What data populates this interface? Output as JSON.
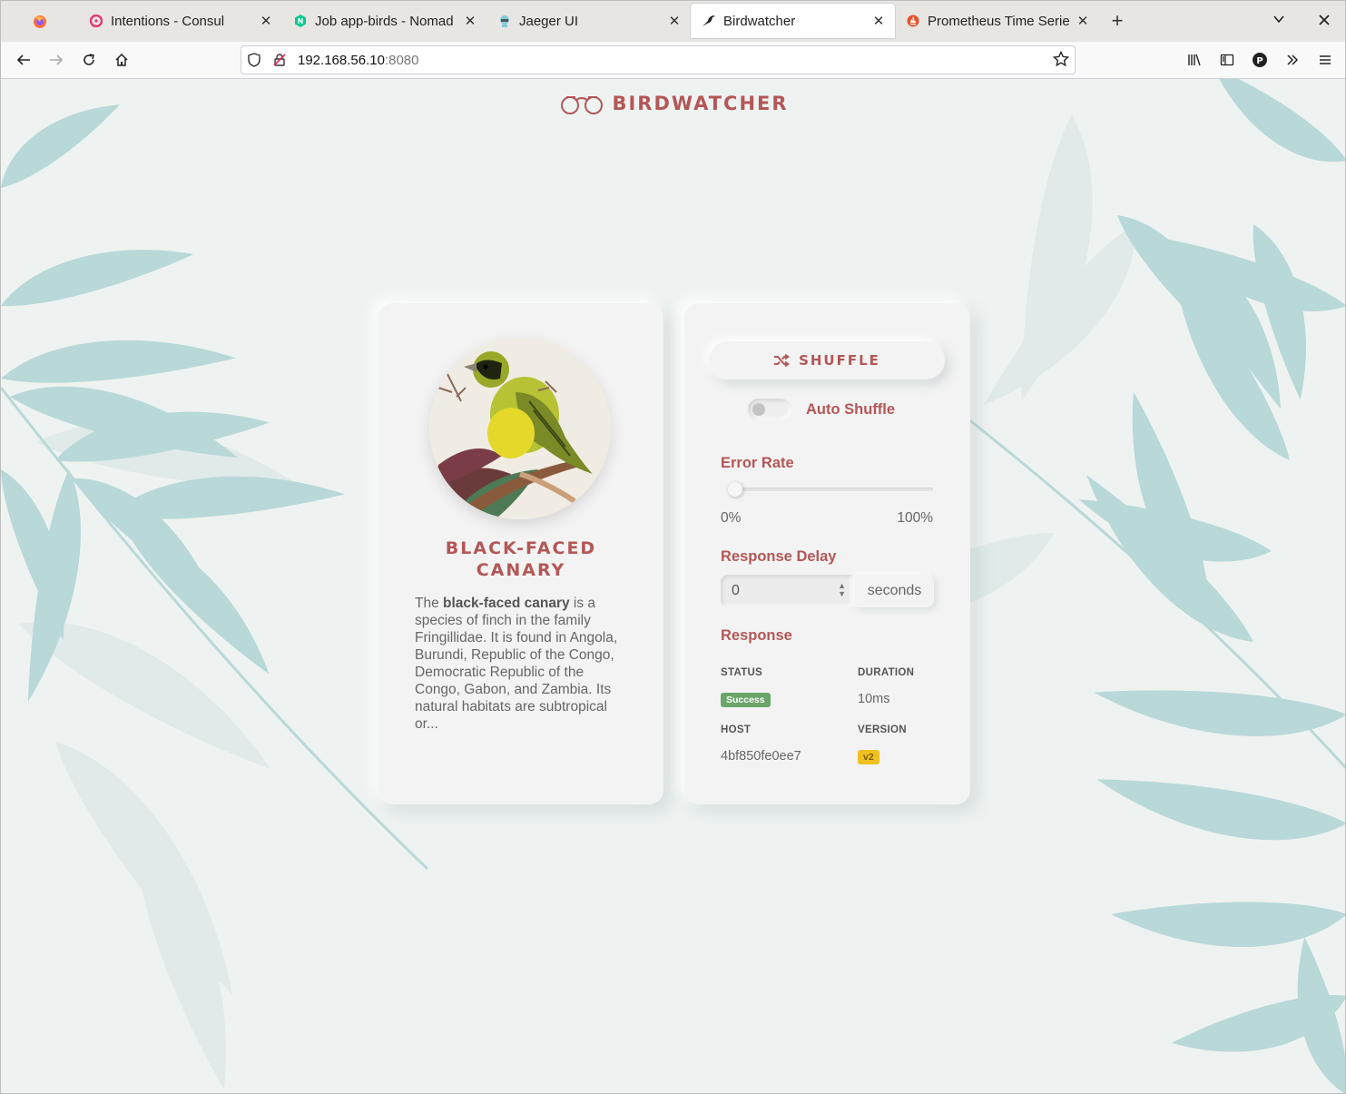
{
  "browser": {
    "tabs": [
      {
        "title": "Intentions - Consul",
        "icon": "consul-icon",
        "active": false
      },
      {
        "title": "Job app-birds - Nomad",
        "icon": "nomad-icon",
        "active": false
      },
      {
        "title": "Jaeger UI",
        "icon": "jaeger-icon",
        "active": false
      },
      {
        "title": "Birdwatcher",
        "icon": "bird-icon",
        "active": true
      },
      {
        "title": "Prometheus Time Series C",
        "icon": "prometheus-icon",
        "active": false
      }
    ],
    "url": {
      "host": "192.168.56.10",
      "port": ":8080"
    }
  },
  "app": {
    "brand": "BIRDWATCHER",
    "bird": {
      "name_line1": "BLACK-FACED",
      "name_line2": "CANARY",
      "desc_pre": "The ",
      "desc_bold": "black-faced canary",
      "desc_post": " is a species of finch in the family Fringillidae. It is found in Angola, Burundi, Republic of the Congo, Democratic Republic of the Congo, Gabon, and Zambia. Its natural habitats are subtropical or..."
    },
    "controls": {
      "shuffle_label": "SHUFFLE",
      "auto_shuffle_label": "Auto Shuffle",
      "auto_shuffle_on": false,
      "error_rate_label": "Error Rate",
      "error_rate_value": 0,
      "error_rate_min": "0%",
      "error_rate_max": "100%",
      "response_delay_label": "Response Delay",
      "response_delay_value": "0",
      "response_delay_unit": "seconds"
    },
    "response": {
      "title": "Response",
      "status_label": "STATUS",
      "status_value": "Success",
      "duration_label": "DURATION",
      "duration_value": "10ms",
      "host_label": "HOST",
      "host_value": "4bf850fe0ee7",
      "version_label": "VERSION",
      "version_value": "v2"
    }
  },
  "colors": {
    "accent": "#b35757",
    "leaf": "#b9d8d8",
    "background": "#eef3f2",
    "success": "#6aa56a",
    "version_badge": "#f0c020"
  }
}
